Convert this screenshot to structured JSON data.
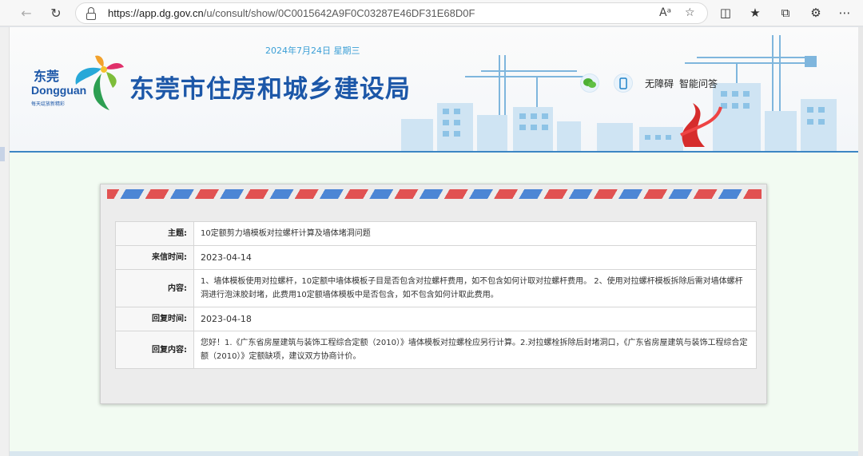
{
  "browser": {
    "url_prefix": "https://app.dg.gov.cn",
    "url_path": "/u/consult/show/0C0015642A9F0C03287E46DF31E68D0F",
    "back_icon": "back-arrow-icon",
    "reload_icon": "reload-icon"
  },
  "header": {
    "date": "2024年7月24日 星期三",
    "logo_cn": "东莞",
    "logo_en": "Dongguan",
    "logo_slogan": "每天绽放新精彩",
    "site_title": "东莞市住房和城乡建设局",
    "accessibility_link": "无障碍",
    "qa_link": "智能问答"
  },
  "consult": {
    "rows": [
      {
        "label": "主题:",
        "value": "10定额剪力墙模板对拉螺杆计算及墙体堵洞问题"
      },
      {
        "label": "来信时间:",
        "value": "2023-04-14"
      },
      {
        "label": "内容:",
        "value": "1、墙体模板使用对拉螺杆，10定额中墙体模板子目是否包含对拉螺杆费用，如不包含如何计取对拉螺杆费用。 2、使用对拉螺杆模板拆除后需对墙体螺杆洞进行泡沫胶封堵，此费用10定额墙体模板中是否包含，如不包含如何计取此费用。"
      },
      {
        "label": "回复时间:",
        "value": "2023-04-18"
      },
      {
        "label": "回复内容:",
        "value": "您好！1.《广东省房屋建筑与装饰工程综合定额（2010）》墙体模板对拉螺栓应另行计算。2.对拉螺栓拆除后封堵洞口，《广东省房屋建筑与装饰工程综合定额（2010）》定额缺项，建议双方协商计价。"
      }
    ]
  },
  "colors": {
    "title_blue": "#1c57a8",
    "stripe_red": "#e15252",
    "stripe_blue": "#4c86d5"
  }
}
